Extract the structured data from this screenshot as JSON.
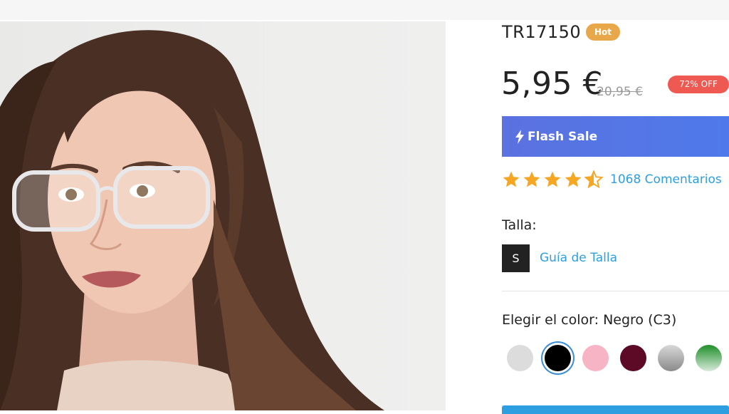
{
  "product": {
    "sku": "TR17150",
    "badge": "Hot",
    "price": "5,95 €",
    "old_price": "20,95 €",
    "discount": "72% OFF",
    "flash_sale": "Flash Sale",
    "rating": 4.5,
    "reviews": "1068 Comentarios",
    "size_label": "Talla:",
    "size_value": "S",
    "size_guide": "Guía de Talla",
    "color_label": "Elegir el color: Negro (C3)",
    "swatches": [
      {
        "name": "light-gray",
        "color": "#dcdcdc",
        "selected": false
      },
      {
        "name": "black",
        "color": "#000000",
        "selected": true
      },
      {
        "name": "pink",
        "color": "#f7b4c5",
        "selected": false
      },
      {
        "name": "burgundy",
        "color": "#5c0a26",
        "selected": false
      },
      {
        "name": "gray-gradient",
        "color": "#9a9a9a",
        "selected": false
      },
      {
        "name": "green-gradient",
        "color": "#2e9b3a",
        "selected": false
      }
    ]
  },
  "colors": {
    "accent_blue": "#2d9fe0",
    "hot_badge": "#e8a84a",
    "discount_badge": "#ee5a52",
    "flash_gradient_start": "#5b72e0",
    "star": "#f5a623"
  },
  "icons": {
    "flash": "lightning-bolt-icon",
    "rating": "star-icon"
  }
}
